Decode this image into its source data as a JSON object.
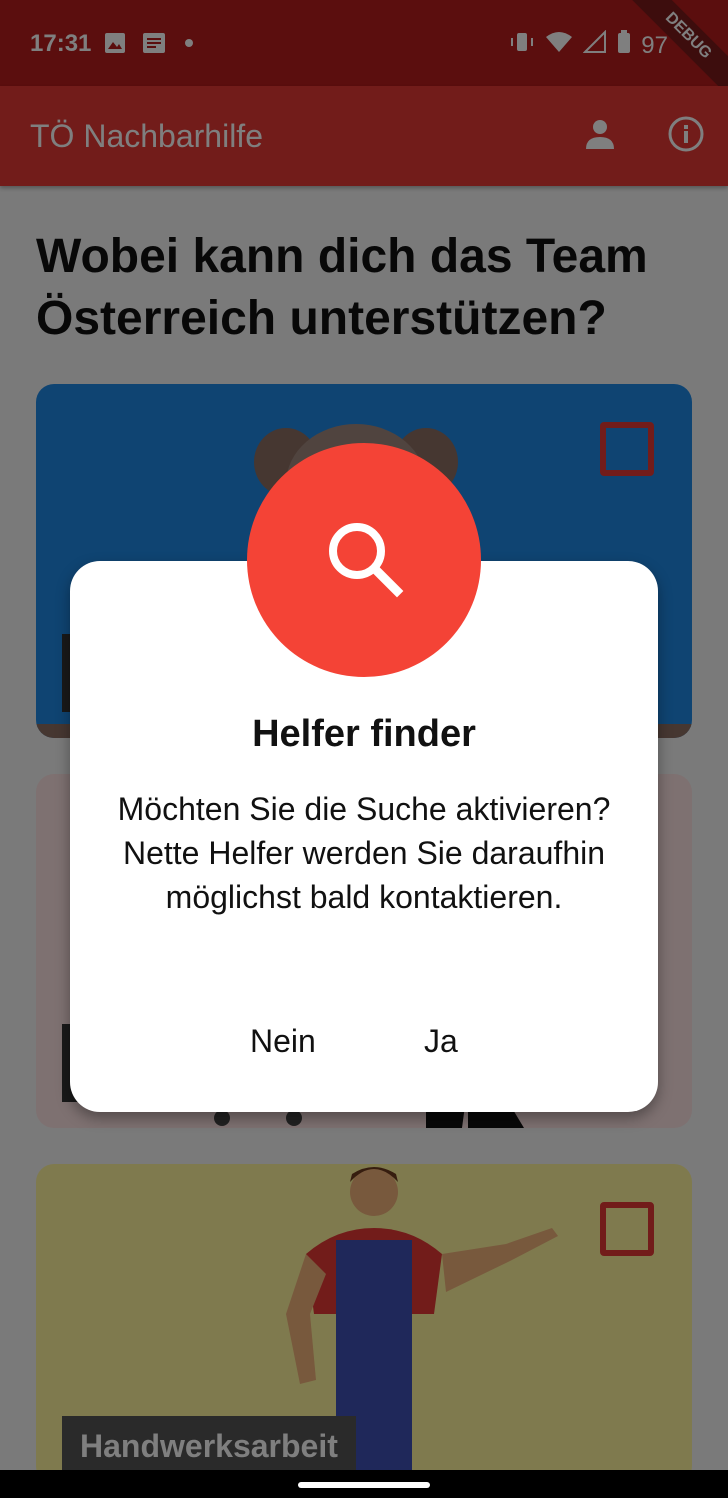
{
  "status_bar": {
    "time": "17:31",
    "battery": "97",
    "debug": "DEBUG"
  },
  "app_bar": {
    "title": "TÖ Nachbarhilfe"
  },
  "page": {
    "heading": "Wobei kann dich das Team Österreich unterstützen?"
  },
  "cards": [
    {
      "label": ""
    },
    {
      "label": ""
    },
    {
      "label": "Handwerksarbeit"
    }
  ],
  "dialog": {
    "title": "Helfer finder",
    "text": "Möchten Sie die Suche aktivieren? Nette Helfer werden Sie daraufhin möglichst bald kontaktieren.",
    "no_label": "Nein",
    "yes_label": "Ja"
  },
  "colors": {
    "primary": "#e53935",
    "status": "#b71c1c",
    "accent_circle": "#f44336"
  }
}
